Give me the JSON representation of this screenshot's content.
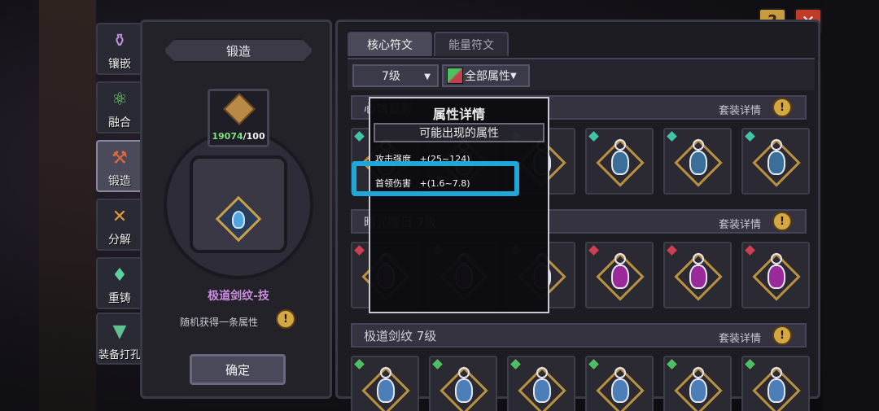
{
  "colors": {
    "accent_highlight": "#1ea7d8",
    "rune_name_purple": "#c98ee0",
    "count_green": "#7fe07f",
    "help_gold": "#c99b3f",
    "close_red": "#c23a2a"
  },
  "top_buttons": {
    "help": "?",
    "close": "✕"
  },
  "side_tabs": [
    {
      "label": "镶嵌",
      "icon": "inlay-icon"
    },
    {
      "label": "融合",
      "icon": "fusion-icon"
    },
    {
      "label": "锻造",
      "icon": "forge-icon",
      "active": true
    },
    {
      "label": "分解",
      "icon": "decompose-icon"
    },
    {
      "label": "重铸",
      "icon": "recast-icon"
    },
    {
      "label": "装备打孔",
      "icon": "socket-icon"
    }
  ],
  "forge": {
    "title": "锻造",
    "material_have": "19074",
    "material_need": "/100",
    "rune_name": "极道剑纹-技",
    "description": "随机获得一条属性",
    "info": "!",
    "confirm": "确定"
  },
  "rune_panel": {
    "tabs": [
      "核心符文",
      "能量符文"
    ],
    "level_select": "7级",
    "attr_select": "全部属性",
    "detail_label": "套装详情",
    "sets": [
      {
        "name": "心蚀意影",
        "dot": "#3ec7a0",
        "frame": "#b8913f",
        "gem": "#3a6f9a"
      },
      {
        "name": "暗光隐日 7级",
        "dot": "#d04050",
        "frame": "#b8913f",
        "gem": "#9a2a9a"
      },
      {
        "name": "极道剑纹 7级",
        "dot": "#4fc060",
        "frame": "#b8913f",
        "gem": "#4a7fb8"
      }
    ]
  },
  "popup": {
    "title": "属性详情",
    "subtitle": "可能出现的属性",
    "attributes": [
      {
        "name": "攻击强度",
        "range": "+(25~124)"
      },
      {
        "name": "首领伤害",
        "range": "+(1.6~7.8)"
      }
    ]
  }
}
